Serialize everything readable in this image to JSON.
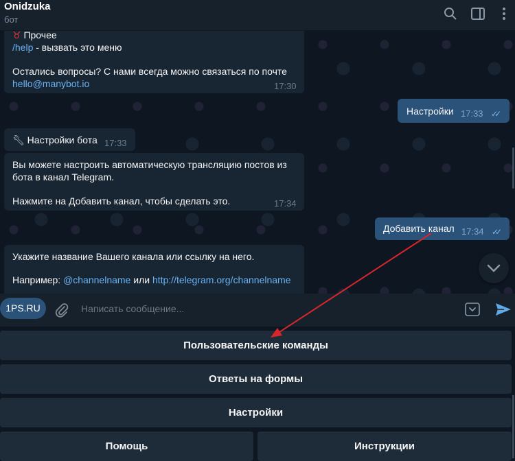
{
  "header": {
    "title": "Onidzuka",
    "subtitle": "бот",
    "icons": [
      "search-icon",
      "sidebar-icon",
      "more-icon"
    ]
  },
  "messages": [
    {
      "direction": "in",
      "emoji_icon": "red-devil-icon",
      "line1": "Прочее",
      "help_cmd": "/help",
      "help_text": " - вызвать это меню",
      "line3": "Остались вопросы? С нами всегда можно связаться по почте",
      "email": "hello@manybot.io",
      "time": "17:30"
    },
    {
      "direction": "out",
      "text": "Настройки",
      "time": "17:33",
      "status": "read"
    },
    {
      "direction": "in",
      "icon": "wrench-icon",
      "text": "Настройки бота",
      "time": "17:33"
    },
    {
      "direction": "in",
      "line1": "Вы можете настроить автоматическую трансляцию постов из",
      "line2": "бота в канал Telegram.",
      "line3": "Нажмите на Добавить канал, чтобы сделать это.",
      "time": "17:34"
    },
    {
      "direction": "out",
      "text": "Добавить канал",
      "time": "17:34",
      "status": "read"
    },
    {
      "direction": "in",
      "line1": "Укажите название Вашего канала или ссылку на него.",
      "example_prefix": "Например: ",
      "example_handle": "@channelname",
      "example_or": " или ",
      "example_url": "http://telegram.org/channelname"
    }
  ],
  "composer": {
    "tag_button": "1PS.RU",
    "placeholder": "Написать сообщение..."
  },
  "keyboard": {
    "row1": "Пользовательские команды",
    "row2": "Ответы на формы",
    "row3": "Настройки",
    "row4_left": "Помощь",
    "row4_right": "Инструкции"
  },
  "colors": {
    "background": "#0e1621",
    "header": "#17212b",
    "incoming_bubble": "#182533",
    "outgoing_bubble": "#2b5278",
    "link": "#6ab3f3",
    "keyboard_button": "#1e2c3a",
    "annotation_arrow": "#d9262b"
  }
}
